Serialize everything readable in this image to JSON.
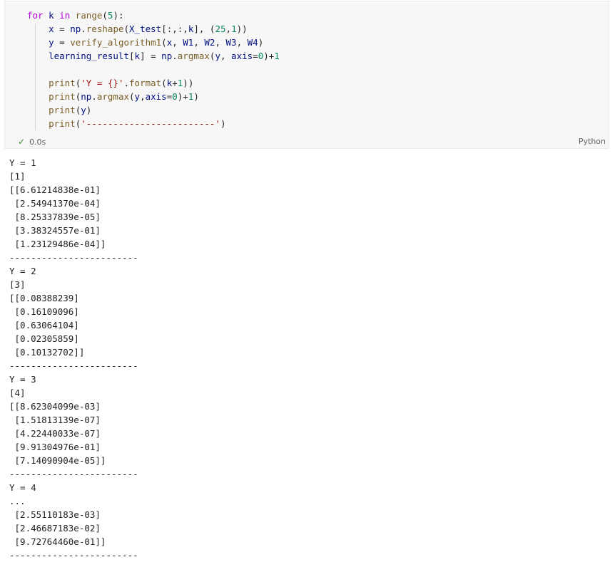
{
  "cell": {
    "code_lines": [
      [
        {
          "t": "for ",
          "c": "kw2"
        },
        {
          "t": "k ",
          "c": "var"
        },
        {
          "t": "in ",
          "c": "kw2"
        },
        {
          "t": "range",
          "c": "fn"
        },
        {
          "t": "(",
          "c": "op"
        },
        {
          "t": "5",
          "c": "num"
        },
        {
          "t": "):",
          "c": "op"
        }
      ],
      [
        {
          "t": "    x ",
          "c": "var"
        },
        {
          "t": "= ",
          "c": "op"
        },
        {
          "t": "np",
          "c": "var"
        },
        {
          "t": ".",
          "c": "op"
        },
        {
          "t": "reshape",
          "c": "fn"
        },
        {
          "t": "(",
          "c": "op"
        },
        {
          "t": "X_test",
          "c": "var"
        },
        {
          "t": "[:,:,",
          "c": "op"
        },
        {
          "t": "k",
          "c": "var"
        },
        {
          "t": "], (",
          "c": "op"
        },
        {
          "t": "25",
          "c": "num"
        },
        {
          "t": ",",
          "c": "op"
        },
        {
          "t": "1",
          "c": "num"
        },
        {
          "t": "))",
          "c": "op"
        }
      ],
      [
        {
          "t": "    y ",
          "c": "var"
        },
        {
          "t": "= ",
          "c": "op"
        },
        {
          "t": "verify_algorithm1",
          "c": "fn"
        },
        {
          "t": "(",
          "c": "op"
        },
        {
          "t": "x",
          "c": "var"
        },
        {
          "t": ", ",
          "c": "op"
        },
        {
          "t": "W1",
          "c": "var"
        },
        {
          "t": ", ",
          "c": "op"
        },
        {
          "t": "W2",
          "c": "var"
        },
        {
          "t": ", ",
          "c": "op"
        },
        {
          "t": "W3",
          "c": "var"
        },
        {
          "t": ", ",
          "c": "op"
        },
        {
          "t": "W4",
          "c": "var"
        },
        {
          "t": ")",
          "c": "op"
        }
      ],
      [
        {
          "t": "    learning_result",
          "c": "var"
        },
        {
          "t": "[",
          "c": "op"
        },
        {
          "t": "k",
          "c": "var"
        },
        {
          "t": "] = ",
          "c": "op"
        },
        {
          "t": "np",
          "c": "var"
        },
        {
          "t": ".",
          "c": "op"
        },
        {
          "t": "argmax",
          "c": "fn"
        },
        {
          "t": "(",
          "c": "op"
        },
        {
          "t": "y",
          "c": "var"
        },
        {
          "t": ", ",
          "c": "op"
        },
        {
          "t": "axis",
          "c": "var"
        },
        {
          "t": "=",
          "c": "op"
        },
        {
          "t": "0",
          "c": "num"
        },
        {
          "t": ")+",
          "c": "op"
        },
        {
          "t": "1",
          "c": "num"
        }
      ],
      [],
      [
        {
          "t": "    print",
          "c": "fn"
        },
        {
          "t": "(",
          "c": "op"
        },
        {
          "t": "'Y = {}'",
          "c": "str"
        },
        {
          "t": ".",
          "c": "op"
        },
        {
          "t": "format",
          "c": "fn"
        },
        {
          "t": "(",
          "c": "op"
        },
        {
          "t": "k",
          "c": "var"
        },
        {
          "t": "+",
          "c": "op"
        },
        {
          "t": "1",
          "c": "num"
        },
        {
          "t": "))",
          "c": "op"
        }
      ],
      [
        {
          "t": "    print",
          "c": "fn"
        },
        {
          "t": "(",
          "c": "op"
        },
        {
          "t": "np",
          "c": "var"
        },
        {
          "t": ".",
          "c": "op"
        },
        {
          "t": "argmax",
          "c": "fn"
        },
        {
          "t": "(",
          "c": "op"
        },
        {
          "t": "y",
          "c": "var"
        },
        {
          "t": ",",
          "c": "op"
        },
        {
          "t": "axis",
          "c": "var"
        },
        {
          "t": "=",
          "c": "op"
        },
        {
          "t": "0",
          "c": "num"
        },
        {
          "t": ")+",
          "c": "op"
        },
        {
          "t": "1",
          "c": "num"
        },
        {
          "t": ")",
          "c": "op"
        }
      ],
      [
        {
          "t": "    print",
          "c": "fn"
        },
        {
          "t": "(",
          "c": "op"
        },
        {
          "t": "y",
          "c": "var"
        },
        {
          "t": ")",
          "c": "op"
        }
      ],
      [
        {
          "t": "    print",
          "c": "fn"
        },
        {
          "t": "(",
          "c": "op"
        },
        {
          "t": "'------------------------'",
          "c": "str"
        },
        {
          "t": ")",
          "c": "op"
        }
      ]
    ],
    "status_time": "0.0s",
    "language": "Python"
  },
  "output_lines": [
    "Y = 1",
    "[1]",
    "[[6.61214838e-01]",
    " [2.54941370e-04]",
    " [8.25337839e-05]",
    " [3.38324557e-01]",
    " [1.23129486e-04]]",
    "------------------------",
    "Y = 2",
    "[3]",
    "[[0.08388239]",
    " [0.16109096]",
    " [0.63064104]",
    " [0.02305859]",
    " [0.10132702]]",
    "------------------------",
    "Y = 3",
    "[4]",
    "[[8.62304099e-03]",
    " [1.51813139e-07]",
    " [4.22440033e-07]",
    " [9.91304976e-01]",
    " [7.14090904e-05]]",
    "------------------------",
    "Y = 4",
    "...",
    " [2.55110183e-03]",
    " [2.46687183e-02]",
    " [9.72764460e-01]]",
    "------------------------"
  ]
}
